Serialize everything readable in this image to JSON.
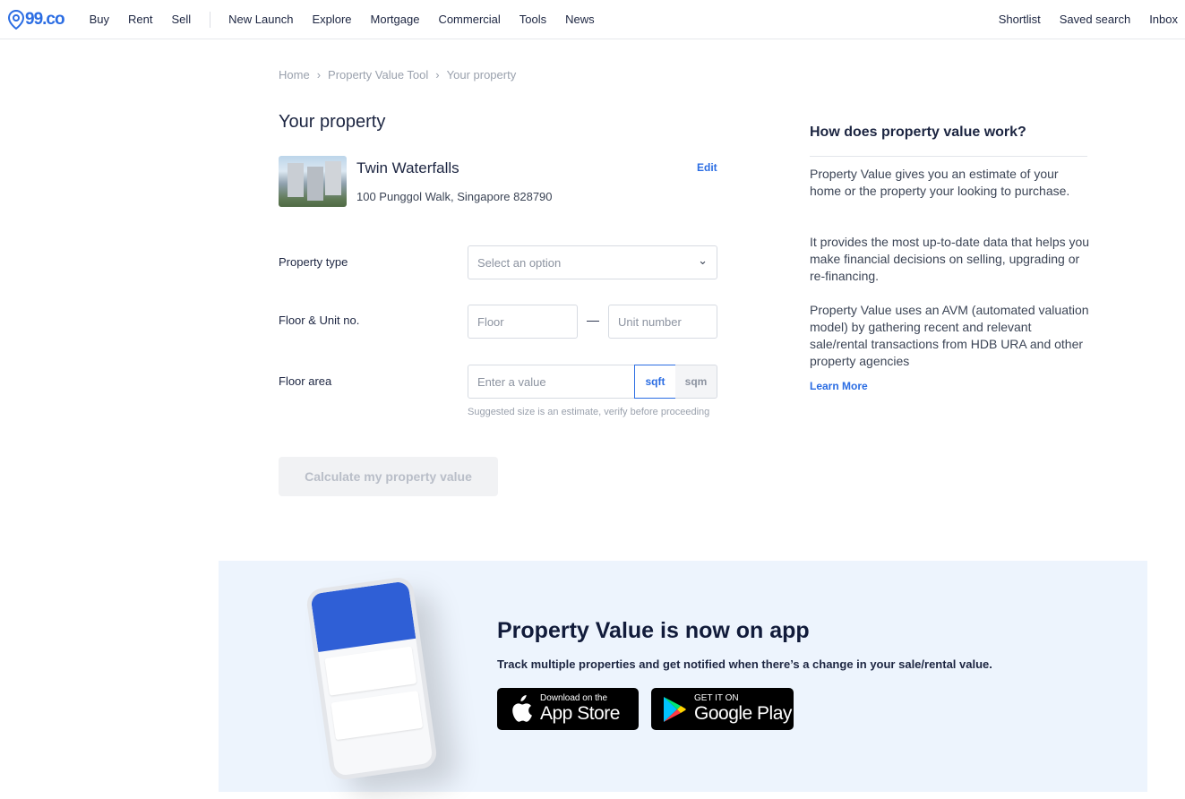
{
  "nav": {
    "logo": "99.co",
    "left": [
      "Buy",
      "Rent",
      "Sell"
    ],
    "main": [
      "New Launch",
      "Explore",
      "Mortgage",
      "Commercial",
      "Tools",
      "News"
    ],
    "right": [
      "Shortlist",
      "Saved search",
      "Inbox"
    ]
  },
  "breadcrumb": [
    "Home",
    "Property Value Tool",
    "Your property"
  ],
  "page_title": "Your property",
  "property": {
    "name": "Twin Waterfalls",
    "address": "100 Punggol Walk, Singapore 828790",
    "edit": "Edit"
  },
  "form": {
    "property_type": {
      "label": "Property type",
      "placeholder": "Select an option"
    },
    "floor_unit": {
      "label": "Floor & Unit no.",
      "floor_placeholder": "Floor",
      "separator": "—",
      "unit_placeholder": "Unit number"
    },
    "floor_area": {
      "label": "Floor area",
      "placeholder": "Enter a value",
      "units": [
        "sqft",
        "sqm"
      ],
      "selected_unit": "sqft",
      "hint": "Suggested size is an estimate, verify before proceeding"
    },
    "submit": "Calculate my property value"
  },
  "sidebar": {
    "title": "How does property value work?",
    "paragraphs": [
      "Property Value gives you an estimate of your home or the property your looking to purchase.",
      "It provides the most up-to-date data that helps you make financial decisions on selling, upgrading or re-financing.",
      "Property Value uses an AVM (automated valuation model) by gathering recent and relevant sale/rental transactions from HDB URA and other property agencies"
    ],
    "learn_more": "Learn More"
  },
  "banner": {
    "title": "Property Value is now on app",
    "subtitle": "Track multiple properties and get notified when there’s a change in your sale/rental value.",
    "app_store": {
      "small": "Download on the",
      "big": "App Store"
    },
    "google_play": {
      "small": "GET IT ON",
      "big": "Google Play"
    }
  },
  "colors": {
    "accent": "#2b6de3",
    "banner_bg": "#edf4fd"
  }
}
